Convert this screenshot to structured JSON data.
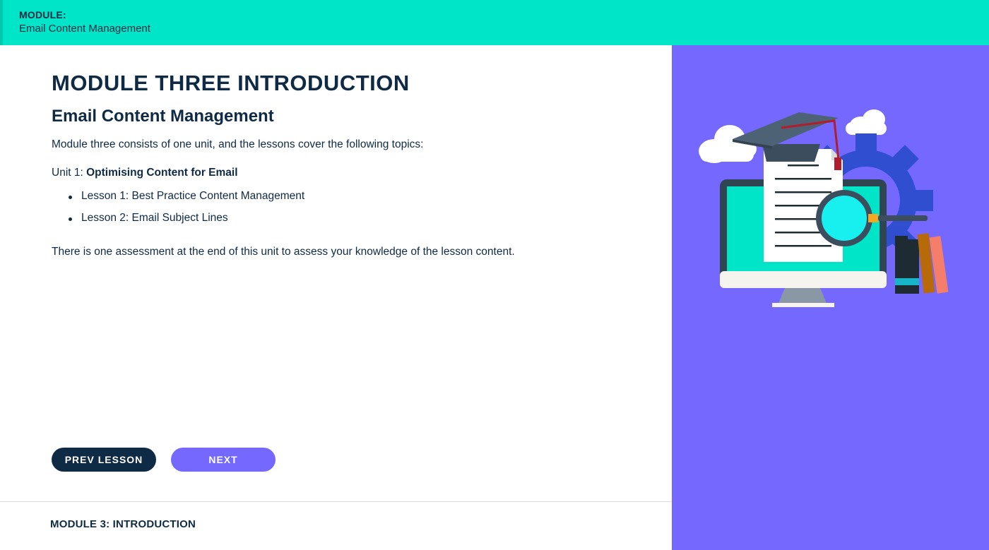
{
  "header": {
    "label": "MODULE:",
    "title": "Email Content Management"
  },
  "main": {
    "title": "MODULE THREE INTRODUCTION",
    "subtitle": "Email Content Management",
    "intro": "Module three consists of one unit, and the lessons cover the following topics:",
    "unit_prefix": "Unit 1: ",
    "unit_name": "Optimising Content for Email",
    "lessons": [
      "Lesson 1: Best Practice Content Management",
      "Lesson 2: Email Subject Lines"
    ],
    "assessment_note": "There is one assessment at the end of this unit to assess your knowledge of the lesson content."
  },
  "nav": {
    "prev_label": "PREV LESSON",
    "next_label": "NEXT"
  },
  "footer": {
    "label": "MODULE 3: INTRODUCTION"
  },
  "colors": {
    "header_bg": "#00e5c8",
    "text": "#0f2a45",
    "accent": "#7468ff",
    "prev_button": "#0f2a45"
  }
}
